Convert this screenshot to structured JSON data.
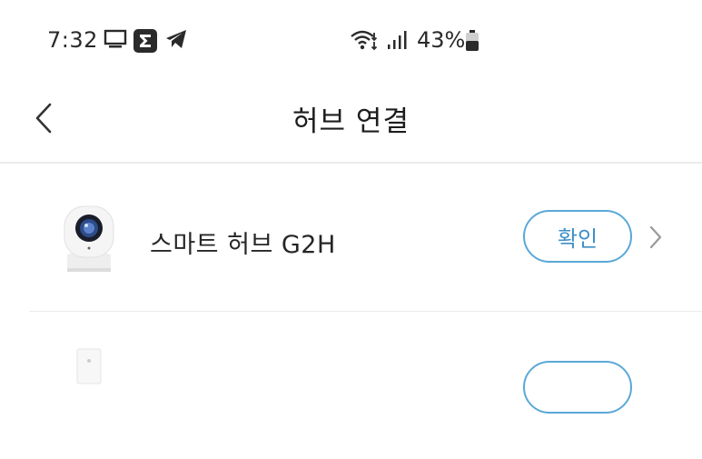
{
  "status_bar": {
    "time": "7:32",
    "battery_percent": "43%",
    "battery_level": 0.43,
    "icons": [
      "monitor-icon",
      "sigma-icon",
      "telegram-icon",
      "wifi-icon",
      "signal-icon",
      "battery-icon"
    ]
  },
  "header": {
    "title": "허브 연결",
    "back_icon": "chevron-left-icon"
  },
  "devices": [
    {
      "name": "스마트 허브 G2H",
      "action_label": "확인",
      "image_icon": "camera-hub-image"
    },
    {
      "name": "",
      "action_label": "",
      "image_icon": "wall-switch-image"
    }
  ],
  "colors": {
    "accent": "#3e8fc8",
    "accent_border": "#5aa8d8",
    "divider": "#ececec",
    "text": "#222222"
  }
}
